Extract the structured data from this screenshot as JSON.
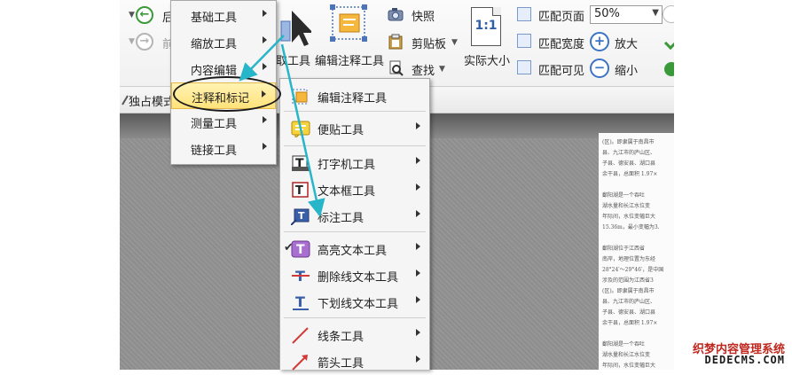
{
  "ribbon": {
    "nav": {
      "back_label": "后",
      "forward_label": "前"
    },
    "tools": {
      "select_label": "取工具",
      "edit_annot_label": "编辑注释工具"
    },
    "clipboard": {
      "snapshot_label": "快照",
      "clipboard_label": "剪贴板",
      "find_label": "查找"
    },
    "actual_size": {
      "icon_text": "1:1",
      "label": "实际大小"
    },
    "fit": {
      "page_label": "匹配页面",
      "width_label": "匹配宽度",
      "visible_label": "匹配可见"
    },
    "zoom": {
      "value": "50%",
      "zoom_in_label": "放大",
      "zoom_out_label": "缩小"
    },
    "bar2_label": "独占模式"
  },
  "menu1": {
    "items": [
      {
        "label": "基础工具"
      },
      {
        "label": "缩放工具"
      },
      {
        "label": "内容编辑"
      },
      {
        "label": "注释和标记"
      },
      {
        "label": "测量工具"
      },
      {
        "label": "链接工具"
      }
    ]
  },
  "menu2": {
    "items": [
      {
        "label": "编辑注释工具",
        "icon": "pencil-edit-icon"
      },
      {
        "label": "便贴工具",
        "icon": "sticky-note-icon"
      },
      {
        "label": "打字机工具",
        "icon": "typewriter-icon"
      },
      {
        "label": "文本框工具",
        "icon": "textbox-icon"
      },
      {
        "label": "标注工具",
        "icon": "callout-icon"
      },
      {
        "label": "高亮文本工具",
        "icon": "highlight-text-icon",
        "checked": true
      },
      {
        "label": "删除线文本工具",
        "icon": "strikeout-text-icon"
      },
      {
        "label": "下划线文本工具",
        "icon": "underline-text-icon"
      },
      {
        "label": "线条工具",
        "icon": "line-icon"
      },
      {
        "label": "箭头工具",
        "icon": "arrow-icon"
      }
    ]
  },
  "document": {
    "lines": [
      "(区)。即隶属于南昌市",
      "县、九江市的庐山区、",
      "子县、德安县、湖口县",
      "余干县，总面积 1.97×",
      "鄱阳湖是一个吞吐",
      "湖水量和长江水位变",
      "年际间，水位变幅巨大",
      "15.36m，最小变幅为3.",
      "鄱阳湖位于江西省",
      "南岸，地理位置为东经",
      "28°24′～29°46′，是中国",
      "涉及的范围为江西省3",
      "(区)。即隶属于南昌市",
      "县、九江市的庐山区、",
      "子县、德安县、湖口县",
      "余干县，总面积 1.97×",
      "鄱阳湖是一个吞吐",
      "湖水量和长江水位变",
      "年际间，水位变幅巨大"
    ]
  },
  "watermark": {
    "line1": "织梦内容管理系统",
    "line2": "DEDECMS.COM"
  },
  "colors": {
    "highlight": "#ffe27a",
    "arrow": "#27b5c9",
    "green": "#3a9a3a",
    "blue": "#3b73c7"
  }
}
